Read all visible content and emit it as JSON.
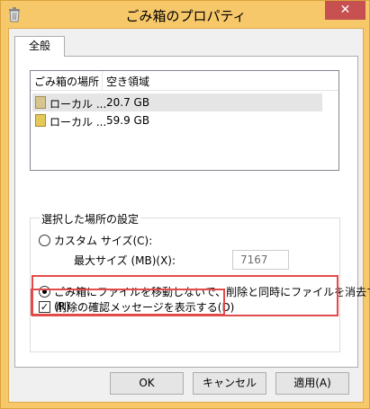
{
  "window": {
    "title": "ごみ箱のプロパティ",
    "close_label": "✕"
  },
  "tabs": [
    {
      "label": "全般"
    }
  ],
  "list": {
    "columns": [
      "ごみ箱の場所",
      "空き領域"
    ],
    "rows": [
      {
        "name": "ローカル ...",
        "space": "20.7 GB",
        "selected": true
      },
      {
        "name": "ローカル ...",
        "space": "59.9 GB",
        "selected": false
      }
    ]
  },
  "settings": {
    "legend": "選択した場所の設定",
    "custom_size_label": "カスタム サイズ(C):",
    "max_size_label": "最大サイズ (MB)(X):",
    "max_size_value": "7167",
    "delete_immediately_label_line1": "ごみ箱にファイルを移動しないで、削除と同時にファイルを消去する",
    "delete_immediately_label_line2": "(R)",
    "custom_size_checked": false,
    "delete_immediately_checked": true
  },
  "confirm": {
    "label": "削除の確認メッセージを表示する(D)",
    "checked": true,
    "check_glyph": "✓"
  },
  "buttons": {
    "ok": "OK",
    "cancel": "キャンセル",
    "apply": "適用(A)"
  }
}
